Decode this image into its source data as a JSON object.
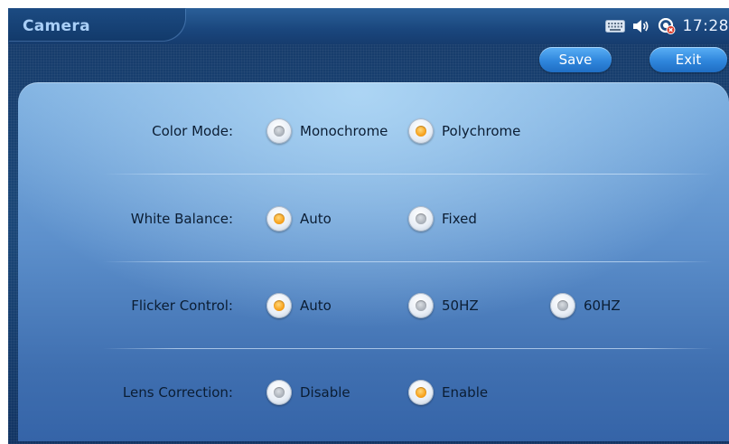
{
  "app": {
    "title": "Camera"
  },
  "status": {
    "clock": "17:28",
    "icons": [
      "keyboard-icon",
      "speaker-icon",
      "network-disconnected-icon"
    ]
  },
  "actions": {
    "save_label": "Save",
    "exit_label": "Exit"
  },
  "colors": {
    "accent_selected": "#f7a21d",
    "panel": "#5c8fcb",
    "topbar": "#1a467d"
  },
  "settings": [
    {
      "label": "Color Mode:",
      "options": [
        {
          "label": "Monochrome",
          "selected": false
        },
        {
          "label": "Polychrome",
          "selected": true
        }
      ]
    },
    {
      "label": "White Balance:",
      "options": [
        {
          "label": "Auto",
          "selected": true
        },
        {
          "label": "Fixed",
          "selected": false
        }
      ]
    },
    {
      "label": "Flicker Control:",
      "options": [
        {
          "label": "Auto",
          "selected": true
        },
        {
          "label": "50HZ",
          "selected": false
        },
        {
          "label": "60HZ",
          "selected": false
        }
      ]
    },
    {
      "label": "Lens Correction:",
      "options": [
        {
          "label": "Disable",
          "selected": false
        },
        {
          "label": "Enable",
          "selected": true
        }
      ]
    }
  ]
}
